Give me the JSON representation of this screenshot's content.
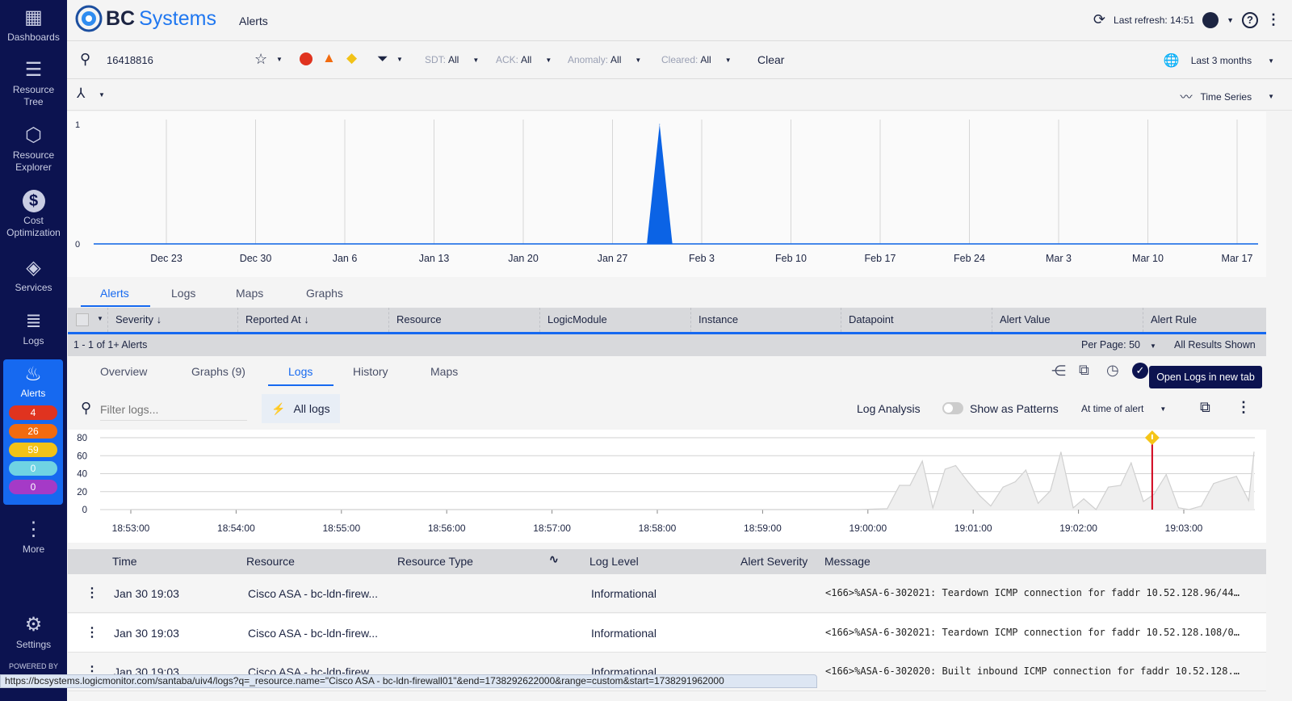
{
  "sidebar": {
    "items": [
      {
        "label": "Dashboards",
        "icon": "dashboards-icon"
      },
      {
        "label": "Resource Tree",
        "icon": "resource-tree-icon"
      },
      {
        "label": "Resource Explorer",
        "icon": "resource-explorer-icon"
      },
      {
        "label": "Cost Optimization",
        "icon": "dollar-icon"
      },
      {
        "label": "Services",
        "icon": "layers-icon"
      },
      {
        "label": "Logs",
        "icon": "logs-icon"
      },
      {
        "label": "Alerts",
        "icon": "flame-icon",
        "active": true
      },
      {
        "label": "More",
        "icon": "more-vertical-icon"
      },
      {
        "label": "Settings",
        "icon": "gear-icon"
      }
    ],
    "alert_counts": [
      {
        "value": "4",
        "color": "#e0331f"
      },
      {
        "value": "26",
        "color": "#f26b0f"
      },
      {
        "value": "59",
        "color": "#f2c217"
      },
      {
        "value": "0",
        "color": "#6fd3e3"
      },
      {
        "value": "0",
        "color": "#a53ac7"
      }
    ],
    "powered_by": "POWERED BY Logic"
  },
  "header": {
    "brand": "BC Systems",
    "page_title": "Alerts",
    "last_refresh": "Last refresh: 14:51"
  },
  "filters": {
    "search_value": "16418816",
    "sdt": {
      "label": "SDT:",
      "value": "All"
    },
    "ack": {
      "label": "ACK:",
      "value": "All"
    },
    "anomaly": {
      "label": "Anomaly:",
      "value": "All"
    },
    "cleared": {
      "label": "Cleared:",
      "value": "All"
    },
    "clear_label": "Clear",
    "time_range": "Last 3 months"
  },
  "chart_toolbar": {
    "view": "Time Series"
  },
  "main_tabs": [
    "Alerts",
    "Logs",
    "Maps",
    "Graphs"
  ],
  "alerts_table": {
    "columns": [
      "Severity",
      "Reported At",
      "Resource",
      "LogicModule",
      "Instance",
      "Datapoint",
      "Alert Value",
      "Alert Rule"
    ],
    "results": "1 - 1 of 1+ Alerts",
    "per_page": "Per Page: 50",
    "all_results": "All Results Shown"
  },
  "detail_tabs": [
    "Overview",
    "Graphs (9)",
    "Logs",
    "History",
    "Maps"
  ],
  "tooltip": "Open Logs in new tab",
  "logs_toolbar": {
    "filter_placeholder": "Filter logs...",
    "all_logs": "All logs",
    "log_analysis": "Log Analysis",
    "show_patterns": "Show as Patterns",
    "patterns_enabled": false,
    "time_mode": "At time of alert"
  },
  "logs_table": {
    "columns": [
      "Time",
      "Resource",
      "Resource Type",
      "Log Level",
      "Alert Severity",
      "Message"
    ],
    "rows": [
      {
        "time": "Jan 30 19:03",
        "resource": "Cisco ASA - bc-ldn-firew...",
        "resource_type": "",
        "log_level": "Informational",
        "alert_severity": "",
        "message": "<166>%ASA-6-302021: Teardown ICMP connection for faddr 10.52.128.96/44…"
      },
      {
        "time": "Jan 30 19:03",
        "resource": "Cisco ASA - bc-ldn-firew...",
        "resource_type": "",
        "log_level": "Informational",
        "alert_severity": "",
        "message": "<166>%ASA-6-302021: Teardown ICMP connection for faddr 10.52.128.108/0…"
      },
      {
        "time": "Jan 30 19:03",
        "resource": "Cisco ASA - bc-ldn-firew...",
        "resource_type": "",
        "log_level": "Informational",
        "alert_severity": "",
        "message": "<166>%ASA-6-302020: Built inbound ICMP connection for faddr 10.52.128.…"
      }
    ]
  },
  "status_url": "https://bcsystems.logicmonitor.com/santaba/uiv4/logs?q=_resource.name=\"Cisco ASA - bc-ldn-firewall01\"&end=1738292622000&range=custom&start=1738291962000",
  "chart_data": [
    {
      "type": "area",
      "ylim": [
        0,
        1
      ],
      "yticks": [
        "0",
        "1"
      ],
      "xticks": [
        "Dec 23",
        "Dec 30",
        "Jan 6",
        "Jan 13",
        "Jan 20",
        "Jan 27",
        "Feb 3",
        "Feb 10",
        "Feb 17",
        "Feb 24",
        "Mar 3",
        "Mar 10",
        "Mar 17"
      ],
      "color": "#0b63e5",
      "grid": "vertical",
      "x": [
        "Jan 29",
        "Jan 30",
        "Jan 31"
      ],
      "values": [
        0,
        1,
        0
      ]
    },
    {
      "type": "area",
      "ylim": [
        0,
        80
      ],
      "yticks": [
        "0",
        "20",
        "40",
        "60",
        "80"
      ],
      "xticks": [
        "18:53:00",
        "18:54:00",
        "18:55:00",
        "18:56:00",
        "18:57:00",
        "18:58:00",
        "18:59:00",
        "19:00:00",
        "19:01:00",
        "19:02:00",
        "19:03:00"
      ],
      "grid": "horizontal",
      "color": "#d0d0d0",
      "alert_marker": {
        "time": "19:02:42",
        "color": "#d0021b",
        "icon": "warning-diamond-icon",
        "icon_color": "#f5c518"
      },
      "x": [
        "18:53:00",
        "18:59:55",
        "19:00:11",
        "19:00:18",
        "19:00:24",
        "19:00:31",
        "19:00:37",
        "19:00:44",
        "19:00:50",
        "19:00:57",
        "19:01:04",
        "19:01:10",
        "19:01:17",
        "19:01:24",
        "19:01:30",
        "19:01:37",
        "19:01:44",
        "19:01:50",
        "19:01:57",
        "19:02:03",
        "19:02:10",
        "19:02:17",
        "19:02:24",
        "19:02:30",
        "19:02:37",
        "19:02:43",
        "19:02:50",
        "19:02:57",
        "19:03:03",
        "19:03:10",
        "19:03:17",
        "19:03:23",
        "19:03:30",
        "19:03:37",
        "19:03:40"
      ],
      "values": [
        0,
        0,
        1,
        27,
        27,
        54,
        2,
        45,
        49,
        31,
        15,
        4,
        25,
        31,
        44,
        7,
        21,
        64,
        2,
        12,
        0,
        25,
        27,
        52,
        9,
        17,
        39,
        2,
        0,
        4,
        29,
        33,
        37,
        10,
        64
      ]
    }
  ]
}
